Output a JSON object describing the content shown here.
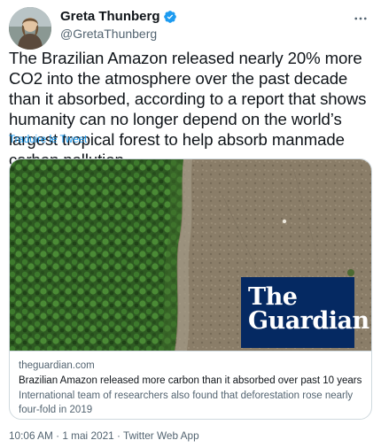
{
  "author": {
    "display_name": "Greta Thunberg",
    "handle": "@GretaThunberg",
    "verified": true
  },
  "tweet": {
    "text": "The Brazilian Amazon released nearly 20% more CO2 into the atmosphere over the past decade than it absorbed, according to a report that shows humanity can no longer depend on the world’s largest tropical forest to help absorb manmade carbon pollution.",
    "translate_label": "Traduire le Tweet",
    "timestamp": "10:06 AM · 1 mai 2021 · Twitter Web App"
  },
  "card": {
    "logo_text": "The Guardian",
    "domain": "theguardian.com",
    "title": "Brazilian Amazon released more carbon than it absorbed over past 10 years",
    "description": "International team of researchers also found that deforestation rose nearly four-fold in 2019"
  },
  "icons": {
    "verified": "verified-badge-icon",
    "more": "more-options-icon"
  },
  "colors": {
    "accent": "#1d9bf0",
    "guardian_blue": "#052962",
    "text_secondary": "#536471"
  }
}
